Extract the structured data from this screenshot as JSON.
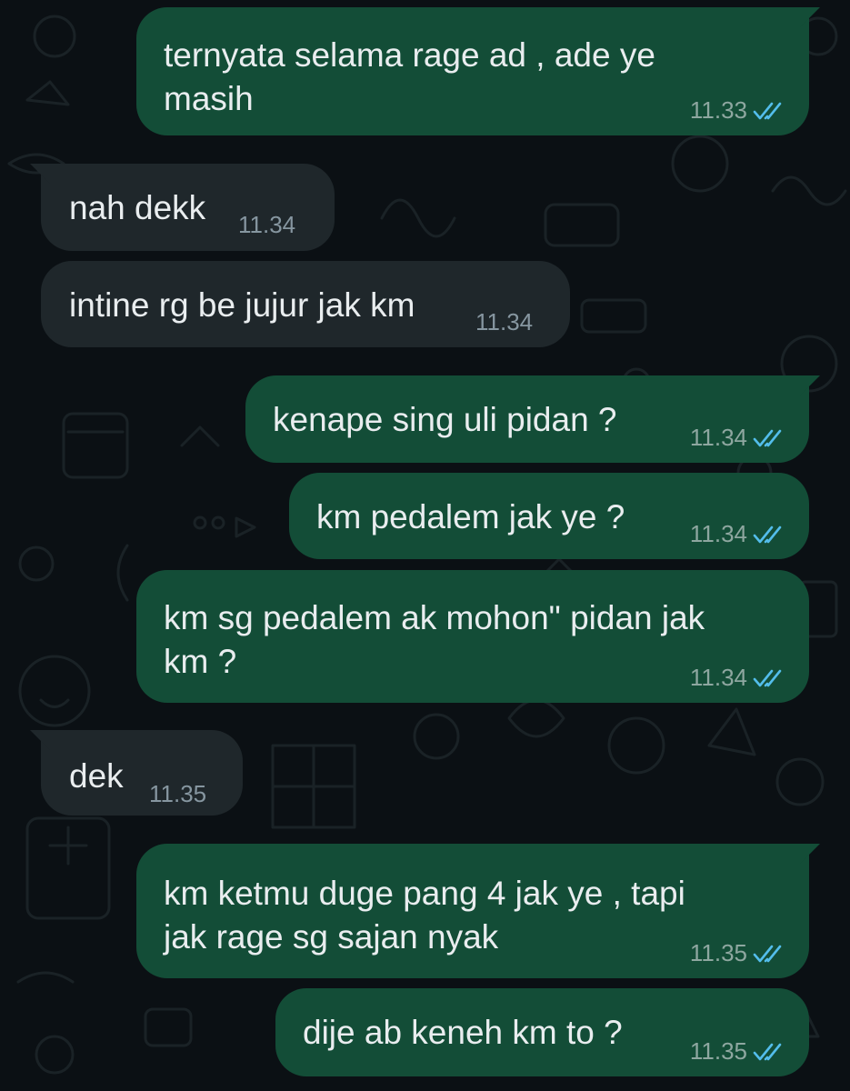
{
  "colors": {
    "background": "#0b1014",
    "outgoing_bubble": "#134d37",
    "incoming_bubble": "#1f272b",
    "text": "#e9edef",
    "read_ticks": "#53bdeb"
  },
  "messages": [
    {
      "direction": "outgoing",
      "lines": [
        "ternyata selama rage ad , ade ye",
        "masih"
      ],
      "time": "11.33",
      "status_icon": "double-check-read-icon"
    },
    {
      "direction": "incoming",
      "lines": [
        "nah dekk"
      ],
      "time": "11.34"
    },
    {
      "direction": "incoming",
      "lines": [
        "intine rg be jujur jak km"
      ],
      "time": "11.34"
    },
    {
      "direction": "outgoing",
      "lines": [
        "kenape sing uli pidan ?"
      ],
      "time": "11.34",
      "status_icon": "double-check-read-icon"
    },
    {
      "direction": "outgoing",
      "lines": [
        "km pedalem jak ye ?"
      ],
      "time": "11.34",
      "status_icon": "double-check-read-icon"
    },
    {
      "direction": "outgoing",
      "lines": [
        "km sg pedalem ak mohon\" pidan jak",
        "km ?"
      ],
      "time": "11.34",
      "status_icon": "double-check-read-icon"
    },
    {
      "direction": "incoming",
      "lines": [
        "dek"
      ],
      "time": "11.35"
    },
    {
      "direction": "outgoing",
      "lines": [
        "km ketmu duge pang 4 jak ye , tapi",
        "jak rage sg sajan nyak"
      ],
      "time": "11.35",
      "status_icon": "double-check-read-icon"
    },
    {
      "direction": "outgoing",
      "lines": [
        "dije ab keneh km to ?"
      ],
      "time": "11.35",
      "status_icon": "double-check-read-icon"
    }
  ]
}
